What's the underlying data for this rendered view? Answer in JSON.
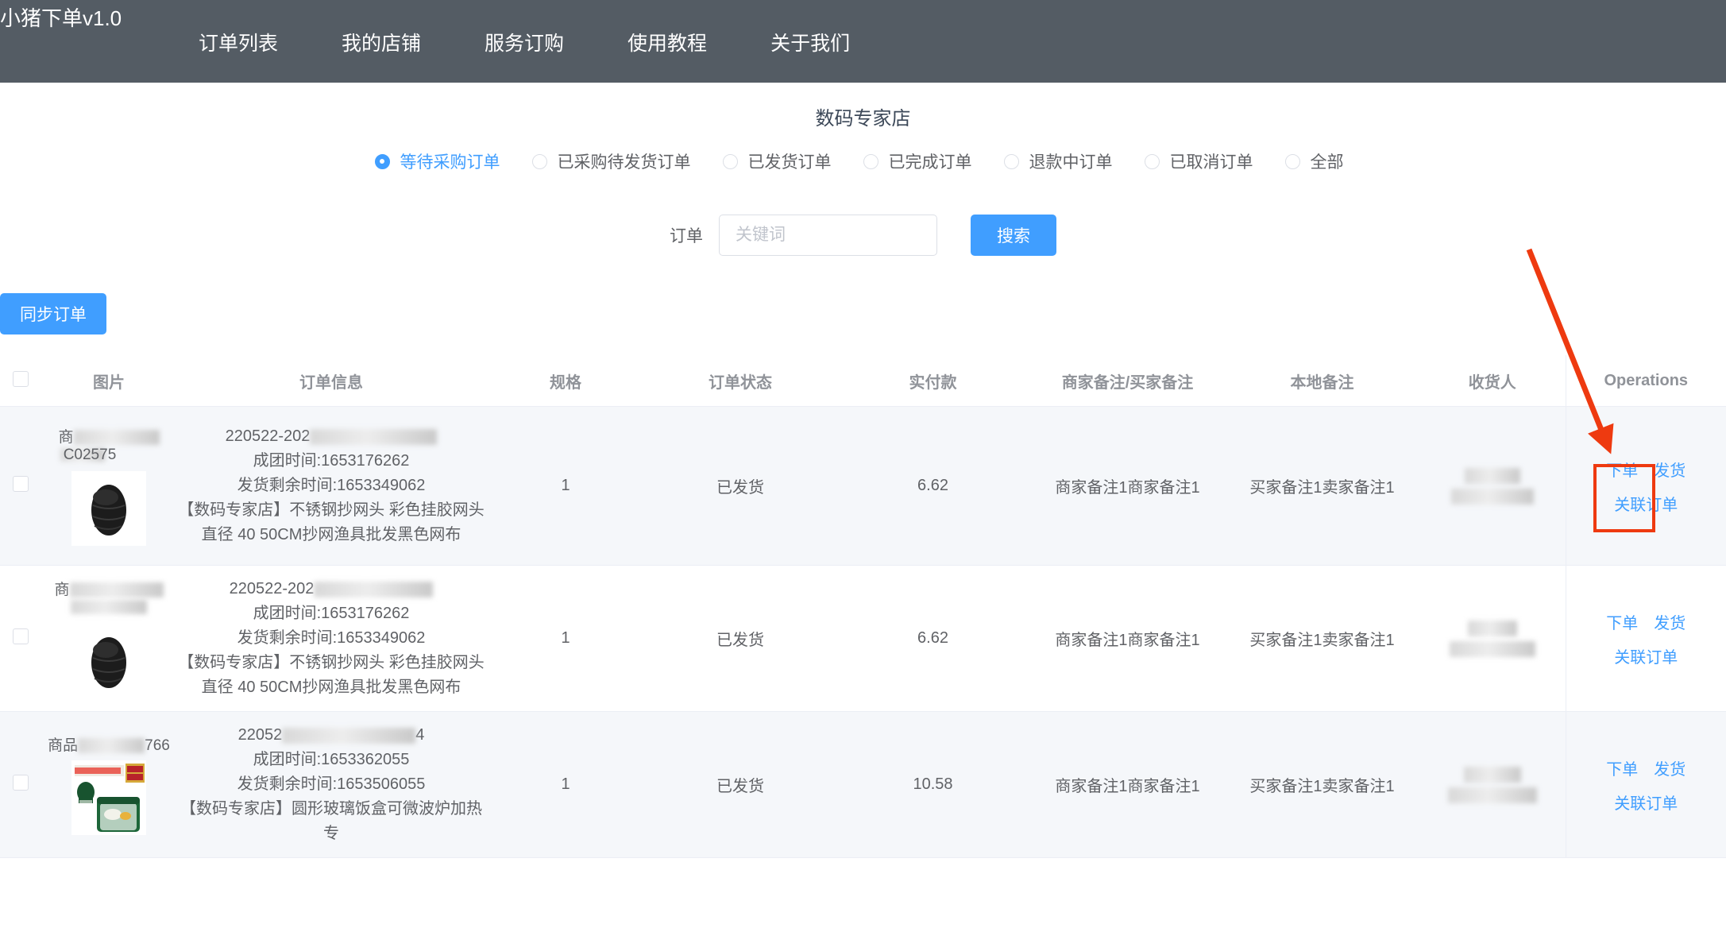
{
  "app": {
    "brand": "小猪下单v1.0",
    "nav": [
      {
        "label": "订单列表"
      },
      {
        "label": "我的店铺"
      },
      {
        "label": "服务订购"
      },
      {
        "label": "使用教程"
      },
      {
        "label": "关于我们"
      }
    ]
  },
  "shop": {
    "title": "数码专家店"
  },
  "filters": {
    "options": [
      {
        "label": "等待采购订单",
        "checked": true
      },
      {
        "label": "已采购待发货订单",
        "checked": false
      },
      {
        "label": "已发货订单",
        "checked": false
      },
      {
        "label": "已完成订单",
        "checked": false
      },
      {
        "label": "退款中订单",
        "checked": false
      },
      {
        "label": "已取消订单",
        "checked": false
      },
      {
        "label": "全部",
        "checked": false
      }
    ]
  },
  "search": {
    "label": "订单",
    "placeholder": "关键词",
    "value": "",
    "button": "搜索"
  },
  "toolbar": {
    "sync_label": "同步订单"
  },
  "table": {
    "headers": [
      "",
      "图片",
      "订单信息",
      "规格",
      "订单状态",
      "实付款",
      "商家备注/买家备注",
      "本地备注",
      "收货人",
      "Operations"
    ],
    "ops": {
      "place_order": "下单",
      "ship": "发货",
      "link_order": "关联订单"
    },
    "rows": [
      {
        "sku_prefix": "商",
        "sku_suffix": "C02575",
        "order_no_prefix": "220522-202",
        "order_no_suffix": "",
        "group_time_label": "成团时间:",
        "group_time": "1653176262",
        "ship_left_label": "发货剩余时间:",
        "ship_left": "1653349062",
        "title_line1": "【数码专家店】不锈钢抄网头 彩色挂胶网头",
        "title_line2": "直径 40 50CM抄网渔具批发黑色网布",
        "spec": "1",
        "status": "已发货",
        "paid": "6.62",
        "merchant_note": "商家备注1商家备注1",
        "local_note": "买家备注1卖家备注1",
        "receiver": "",
        "thumb": "net-head"
      },
      {
        "sku_prefix": "商",
        "sku_suffix": "",
        "order_no_prefix": "220522-202",
        "order_no_suffix": "",
        "group_time_label": "成团时间:",
        "group_time": "1653176262",
        "ship_left_label": "发货剩余时间:",
        "ship_left": "1653349062",
        "title_line1": "【数码专家店】不锈钢抄网头 彩色挂胶网头",
        "title_line2": "直径 40 50CM抄网渔具批发黑色网布",
        "spec": "1",
        "status": "已发货",
        "paid": "6.62",
        "merchant_note": "商家备注1商家备注1",
        "local_note": "买家备注1卖家备注1",
        "receiver": "",
        "thumb": "net-head"
      },
      {
        "sku_prefix": "商品",
        "sku_suffix": "766",
        "order_no_prefix": "22052",
        "order_no_suffix": "4",
        "group_time_label": "成团时间:",
        "group_time": "1653362055",
        "ship_left_label": "发货剩余时间:",
        "ship_left": "1653506055",
        "title_line1": "【数码专家店】圆形玻璃饭盒可微波炉加热专",
        "title_line2": "",
        "spec": "1",
        "status": "已发货",
        "paid": "10.58",
        "merchant_note": "商家备注1商家备注1",
        "local_note": "买家备注1卖家备注1",
        "receiver": "",
        "thumb": "glass-box"
      }
    ]
  },
  "annotation": {
    "arrow_color": "#ee3a10",
    "highlight_target": "下单"
  }
}
